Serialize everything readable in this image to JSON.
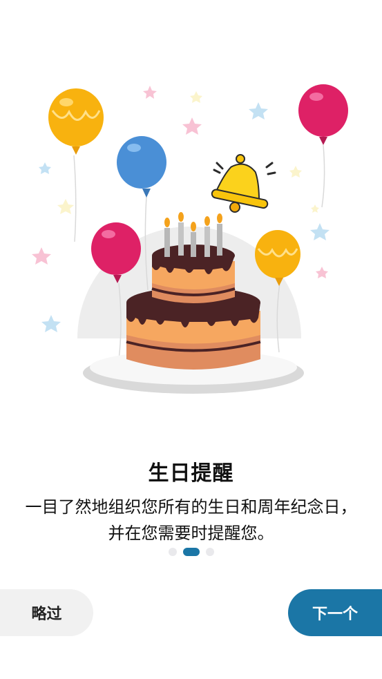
{
  "onboarding": {
    "title": "生日提醒",
    "description": "一目了然地组织您所有的生日和周年纪念日，并在您需要时提醒您。",
    "pager": {
      "total_pages": 3,
      "current_page": 2
    },
    "skip_label": "略过",
    "next_label": "下一个",
    "illustration": "birthday-cake-balloons-bell"
  },
  "colors": {
    "accent": "#1b76a6",
    "skip_bg": "#f1f1f1",
    "dot_inactive": "#e9e9ec"
  }
}
